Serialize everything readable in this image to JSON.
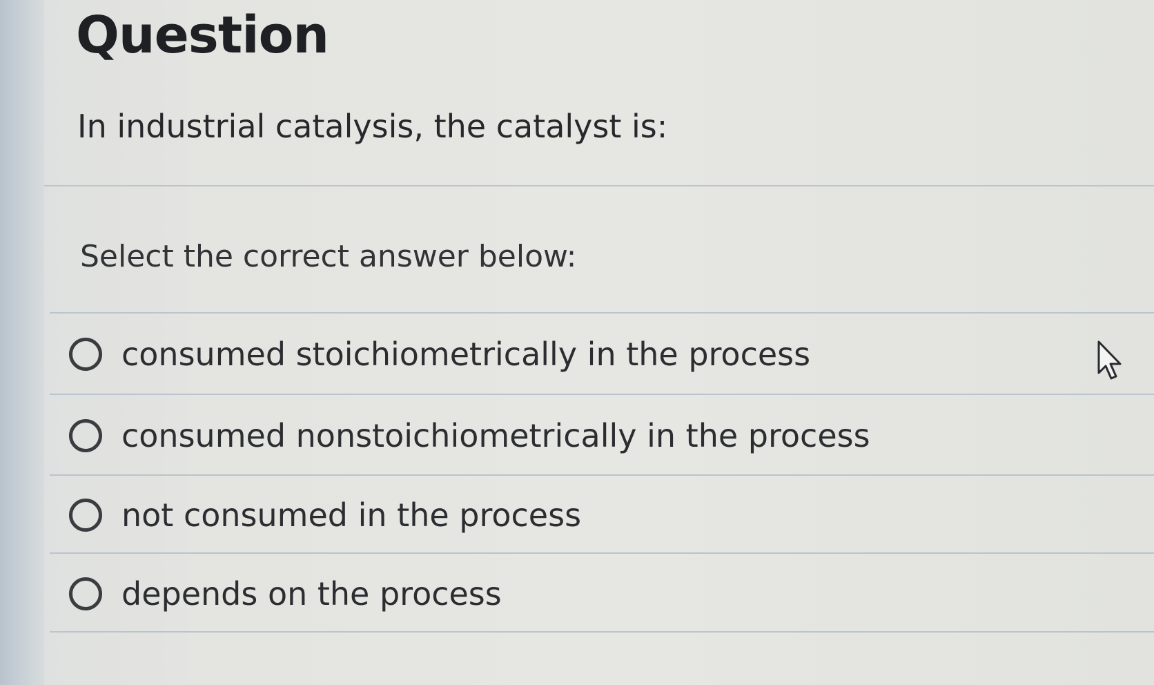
{
  "question": {
    "heading": "Question",
    "prompt": "In industrial catalysis, the catalyst is:",
    "instruction": "Select the correct answer below:",
    "options": [
      {
        "label": "consumed stoichiometrically in the process",
        "selected": false
      },
      {
        "label": "consumed nonstoichiometrically in the process",
        "selected": false
      },
      {
        "label": "not consumed in the process",
        "selected": false
      },
      {
        "label": "depends on the process",
        "selected": false
      }
    ]
  },
  "icons": {
    "option_radio": "radio-unchecked-icon",
    "pointer": "mouse-pointer-icon"
  },
  "colors": {
    "text": "#2c2d31",
    "divider": "#b9c4cc",
    "background": "#e4e4e1"
  }
}
